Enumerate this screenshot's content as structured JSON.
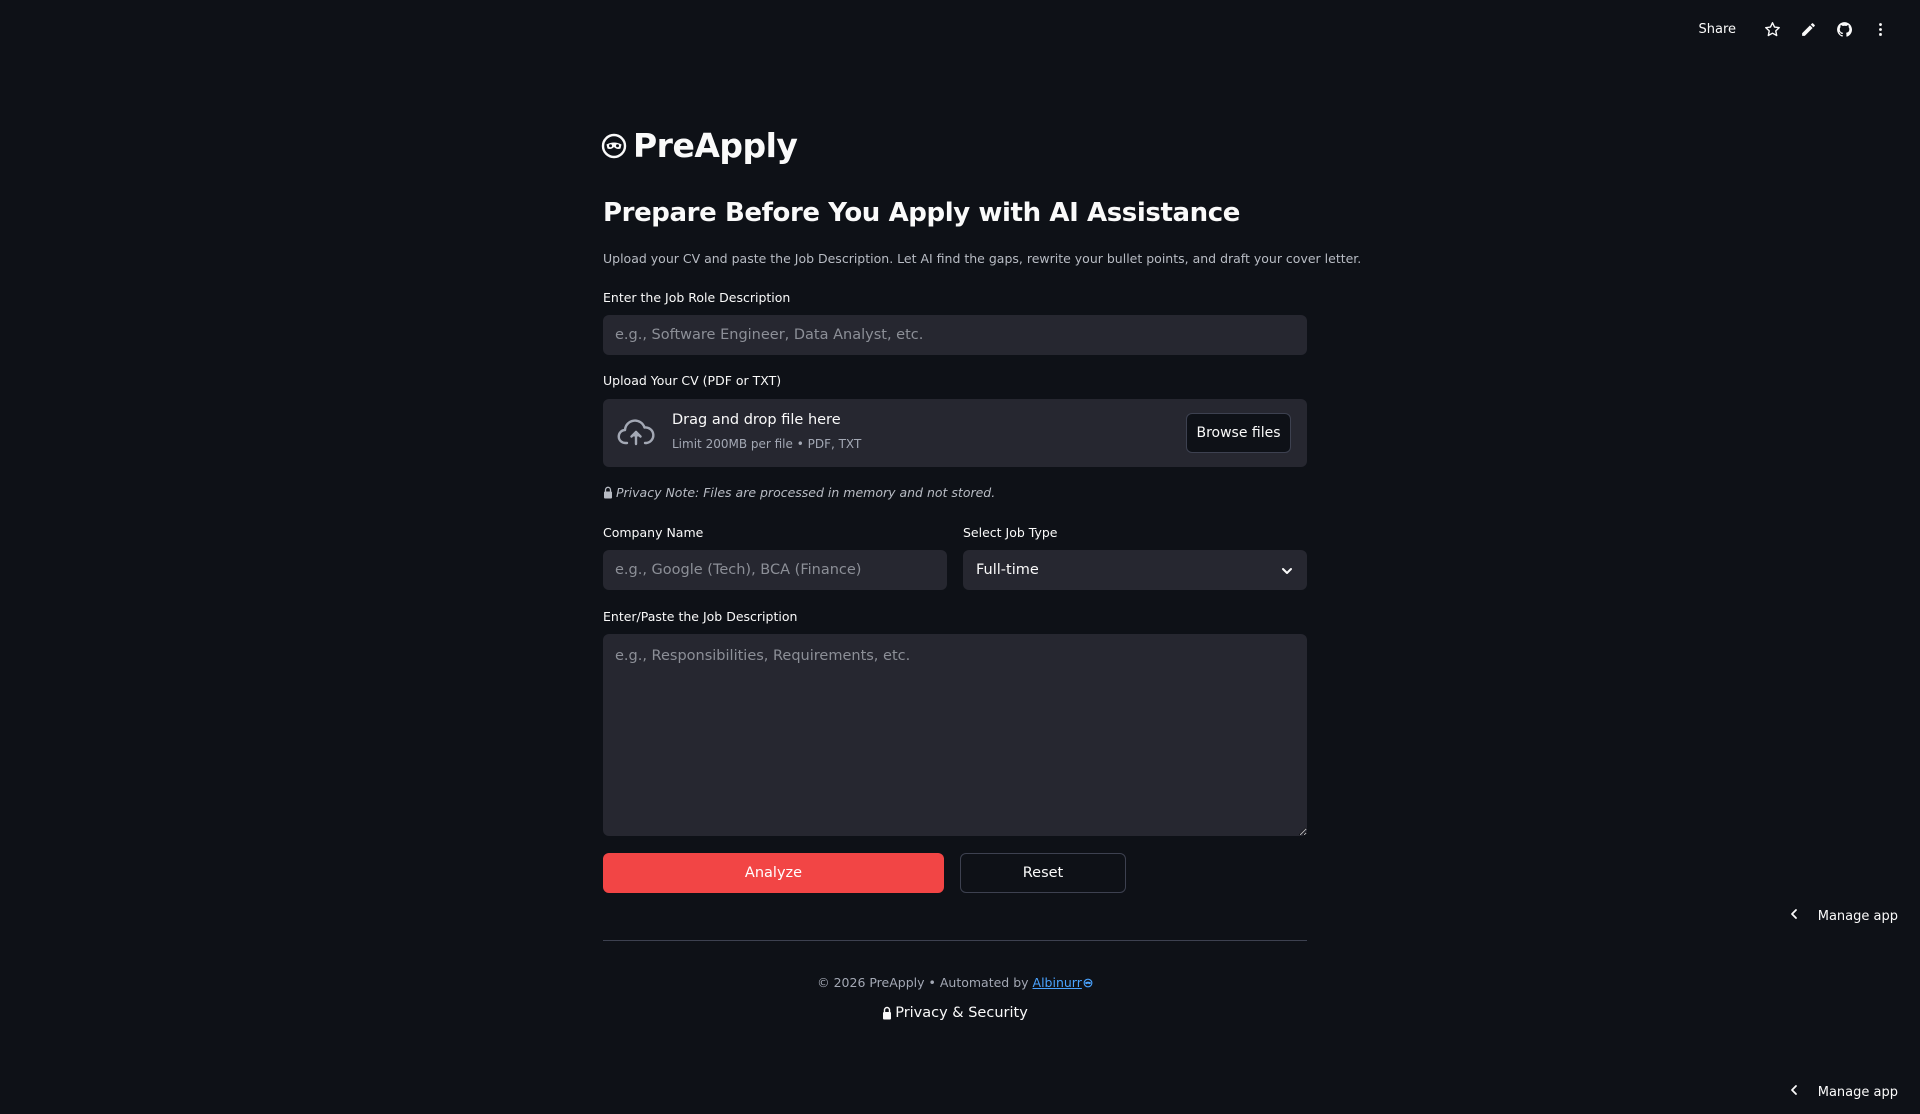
{
  "toolbar": {
    "share_label": "Share",
    "icons": [
      "star-icon",
      "pencil-icon",
      "github-icon",
      "kebab-menu-icon"
    ]
  },
  "app": {
    "title": "PreApply",
    "logo_icon": "mask-logo-icon"
  },
  "header": {
    "headline": "Prepare Before You Apply with AI Assistance",
    "subtitle": "Upload your CV and paste the Job Description. Let AI find the gaps, rewrite your bullet points, and draft your cover letter."
  },
  "job_role": {
    "label": "Enter the Job Role Description",
    "placeholder": "e.g., Software Engineer, Data Analyst, etc.",
    "value": ""
  },
  "cv_upload": {
    "label": "Upload Your CV (PDF or TXT)",
    "drag_text": "Drag and drop file here",
    "limit_text": "Limit 200MB per file • PDF, TXT",
    "browse_label": "Browse files",
    "icon": "cloud-upload-icon"
  },
  "privacy_note": "Privacy Note: Files are processed in memory and not stored.",
  "company": {
    "label": "Company Name",
    "placeholder": "e.g., Google (Tech), BCA (Finance)",
    "value": ""
  },
  "job_type": {
    "label": "Select Job Type",
    "selected": "Full-time"
  },
  "job_description": {
    "label": "Enter/Paste the Job Description",
    "placeholder": "e.g., Responsibilities, Requirements, etc.",
    "value": ""
  },
  "actions": {
    "analyze_label": "Analyze",
    "reset_label": "Reset"
  },
  "footer": {
    "copyright": "© 2026 PreApply • Automated by",
    "author_link": "Albinurr",
    "privacy_label": "Privacy & Security"
  },
  "manage_app": {
    "label": "Manage app"
  },
  "colors": {
    "background": "#0e1117",
    "input_bg": "#262730",
    "primary": "#f24545",
    "link": "#4aa3ff"
  }
}
